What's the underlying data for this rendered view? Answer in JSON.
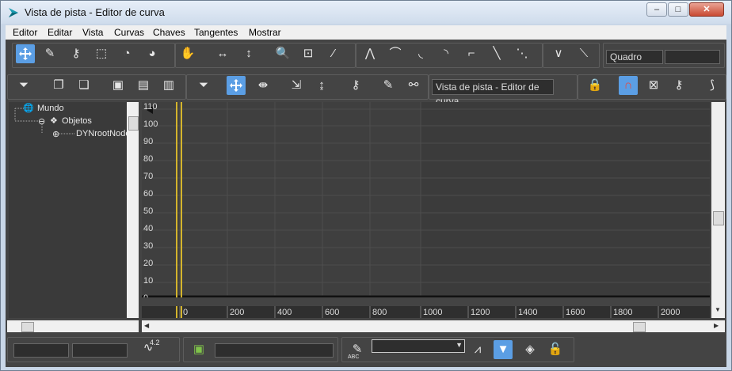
{
  "window": {
    "title": "Vista de pista - Editor de curva",
    "min_label": "–",
    "max_label": "□",
    "close_label": "✕"
  },
  "menu": [
    "Editor",
    "Editar",
    "Vista",
    "Curvas",
    "Chaves",
    "Tangentes",
    "Mostrar"
  ],
  "toolbar": {
    "frame_label": "Quadro",
    "track_view_name": "Vista de pista - Editor de curva",
    "curve_badge": "4.2"
  },
  "tree": {
    "root": "Mundo",
    "child": "Objetos",
    "leaf": "DYNrootNode"
  },
  "graph": {
    "y_ticks": [
      "110",
      "100",
      "90",
      "80",
      "70",
      "60",
      "50",
      "40",
      "30",
      "20",
      "10",
      "0"
    ],
    "x_ticks": [
      "0",
      "200",
      "400",
      "600",
      "800",
      "1000",
      "1200",
      "1400",
      "1600",
      "1800",
      "2000"
    ]
  },
  "status": {
    "abc_label": "ABC"
  },
  "colors": {
    "panel": "#444444",
    "graph_bg": "#3b3b3b",
    "accent": "#5b9ee4",
    "time_slider": "#d4b42c"
  },
  "icons": {
    "move-keys": "move-keys-icon",
    "lock": "lock-icon",
    "snap": "snap-icon",
    "pan": "hand-icon",
    "zoom": "zoom-icon"
  }
}
